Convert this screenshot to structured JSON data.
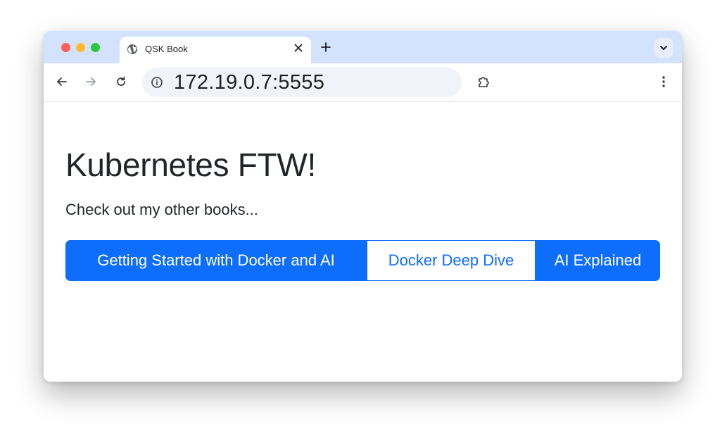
{
  "browser": {
    "tab": {
      "title": "QSK Book",
      "favicon": "globe-icon",
      "close_icon": "close-icon"
    },
    "new_tab_icon": "plus-icon",
    "tab_search_icon": "chevron-down-icon",
    "toolbar": {
      "back_icon": "arrow-left-icon",
      "forward_icon": "arrow-right-icon",
      "reload_icon": "reload-icon",
      "site_info_icon": "info-icon",
      "url": "172.19.0.7:5555",
      "extensions_icon": "puzzle-icon",
      "menu_icon": "kebab-menu-icon"
    },
    "colors": {
      "tabstrip_bg": "#d3e3fd",
      "primary": "#0d6efd",
      "text": "#212529"
    }
  },
  "page": {
    "heading": "Kubernetes FTW!",
    "subtext": "Check out my other books...",
    "buttons": [
      {
        "label": "Getting Started with Docker and AI",
        "style": "primary"
      },
      {
        "label": "Docker Deep Dive",
        "style": "outline"
      },
      {
        "label": "AI Explained",
        "style": "primary"
      }
    ]
  }
}
